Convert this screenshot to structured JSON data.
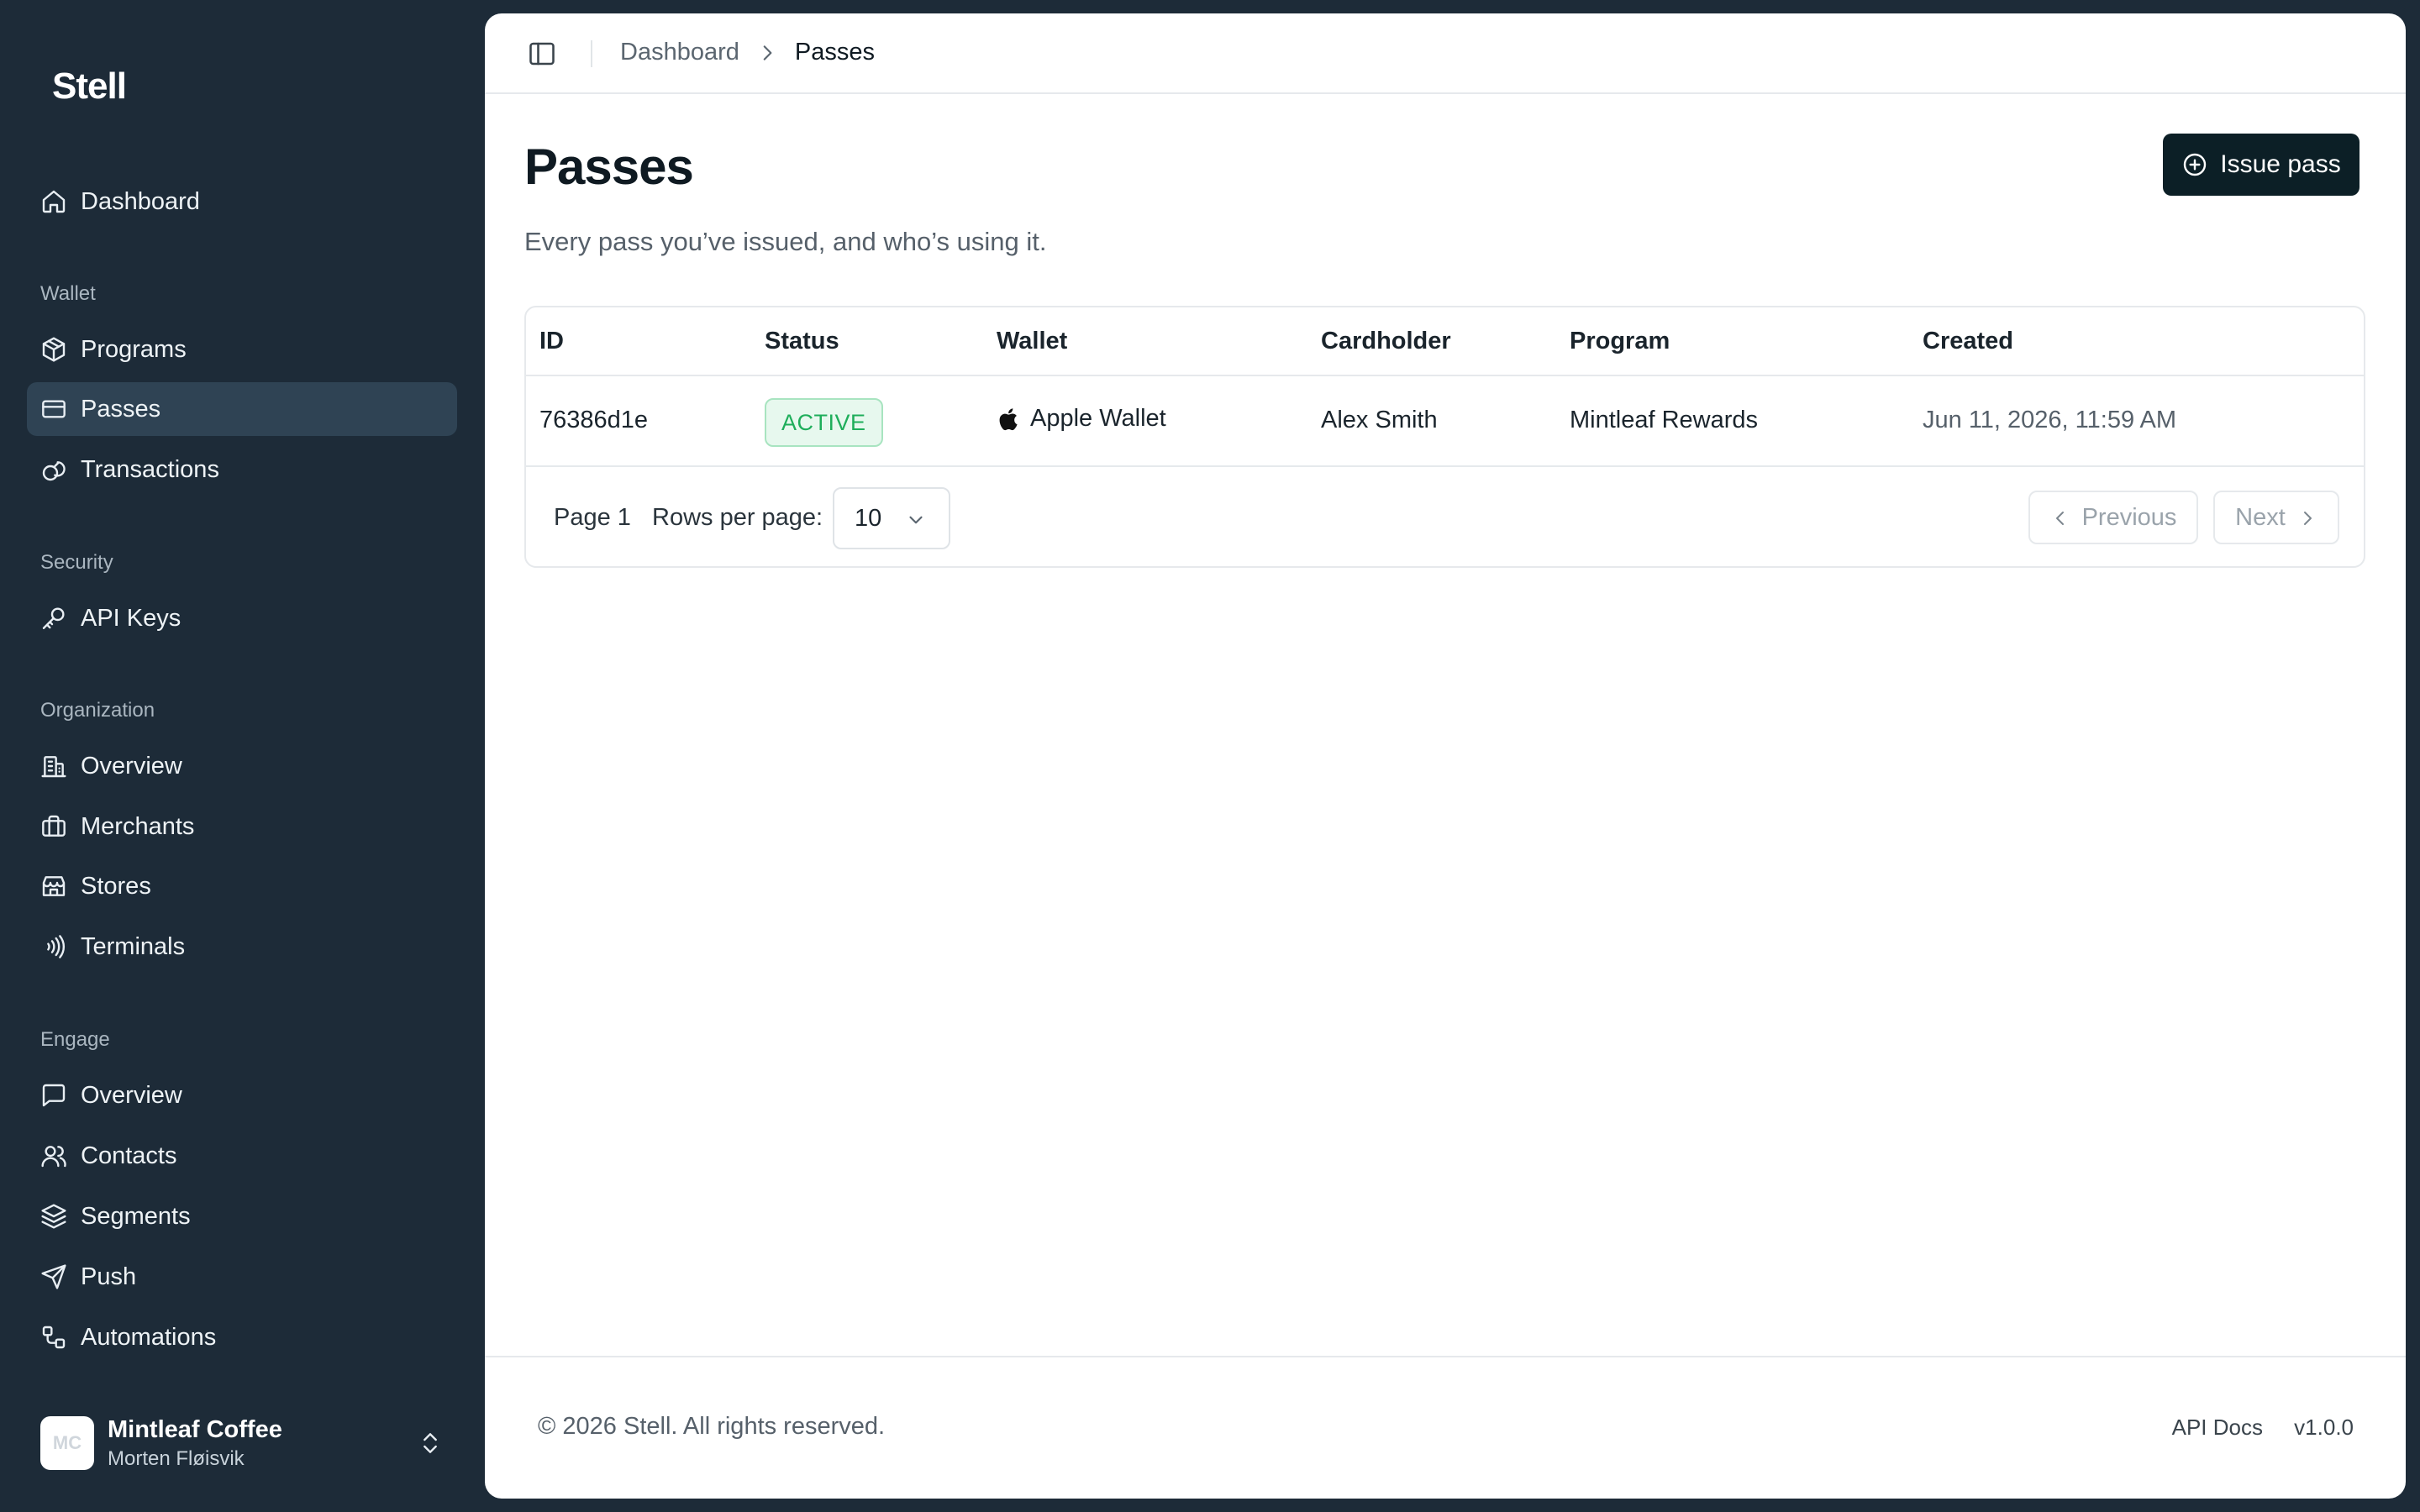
{
  "brand": "Stell",
  "sidebar": {
    "dashboard": "Dashboard",
    "sections": {
      "wallet": "Wallet",
      "security": "Security",
      "organization": "Organization",
      "engage": "Engage"
    },
    "items": {
      "programs": "Programs",
      "passes": "Passes",
      "transactions": "Transactions",
      "api_keys": "API Keys",
      "org_overview": "Overview",
      "merchants": "Merchants",
      "stores": "Stores",
      "terminals": "Terminals",
      "engage_overview": "Overview",
      "contacts": "Contacts",
      "segments": "Segments",
      "push": "Push",
      "automations": "Automations"
    },
    "active_item": "Passes",
    "org": {
      "avatar_initials": "MC",
      "name": "Mintleaf Coffee",
      "user": "Morten Fløisvik"
    }
  },
  "breadcrumb": {
    "parent": "Dashboard",
    "current": "Passes"
  },
  "page": {
    "title": "Passes",
    "subtitle": "Every pass you’ve issued, and who’s using it.",
    "primary_action": "Issue pass"
  },
  "table": {
    "columns": {
      "id": "ID",
      "status": "Status",
      "wallet": "Wallet",
      "cardholder": "Cardholder",
      "program": "Program",
      "created": "Created"
    },
    "rows": [
      {
        "id": "76386d1e",
        "status": "ACTIVE",
        "wallet": "Apple Wallet",
        "cardholder": "Alex Smith",
        "program": "Mintleaf Rewards",
        "created": "Jun 11, 2026, 11:59 AM"
      }
    ]
  },
  "pagination": {
    "page_label": "Page 1",
    "rows_per_page_label": "Rows per page:",
    "rows_per_page_value": "10",
    "previous": "Previous",
    "next": "Next"
  },
  "footer": {
    "copyright": "© 2026 Stell. All rights reserved.",
    "api_docs": "API Docs",
    "version": "v1.0.0"
  },
  "colors": {
    "sidebar_bg": "#1d2b38",
    "sidebar_active": "#2f4354",
    "primary_button": "#0c1f26",
    "status_active": "#1fae5b"
  },
  "icons": {
    "dashboard": "home-icon",
    "programs": "package-icon",
    "passes": "credit-card-icon",
    "transactions": "coins-icon",
    "api_keys": "key-icon",
    "org_overview": "building-icon",
    "merchants": "briefcase-icon",
    "stores": "store-icon",
    "terminals": "contactless-icon",
    "engage_overview": "message-square-icon",
    "contacts": "users-icon",
    "segments": "layers-icon",
    "push": "send-icon",
    "automations": "workflow-icon"
  }
}
